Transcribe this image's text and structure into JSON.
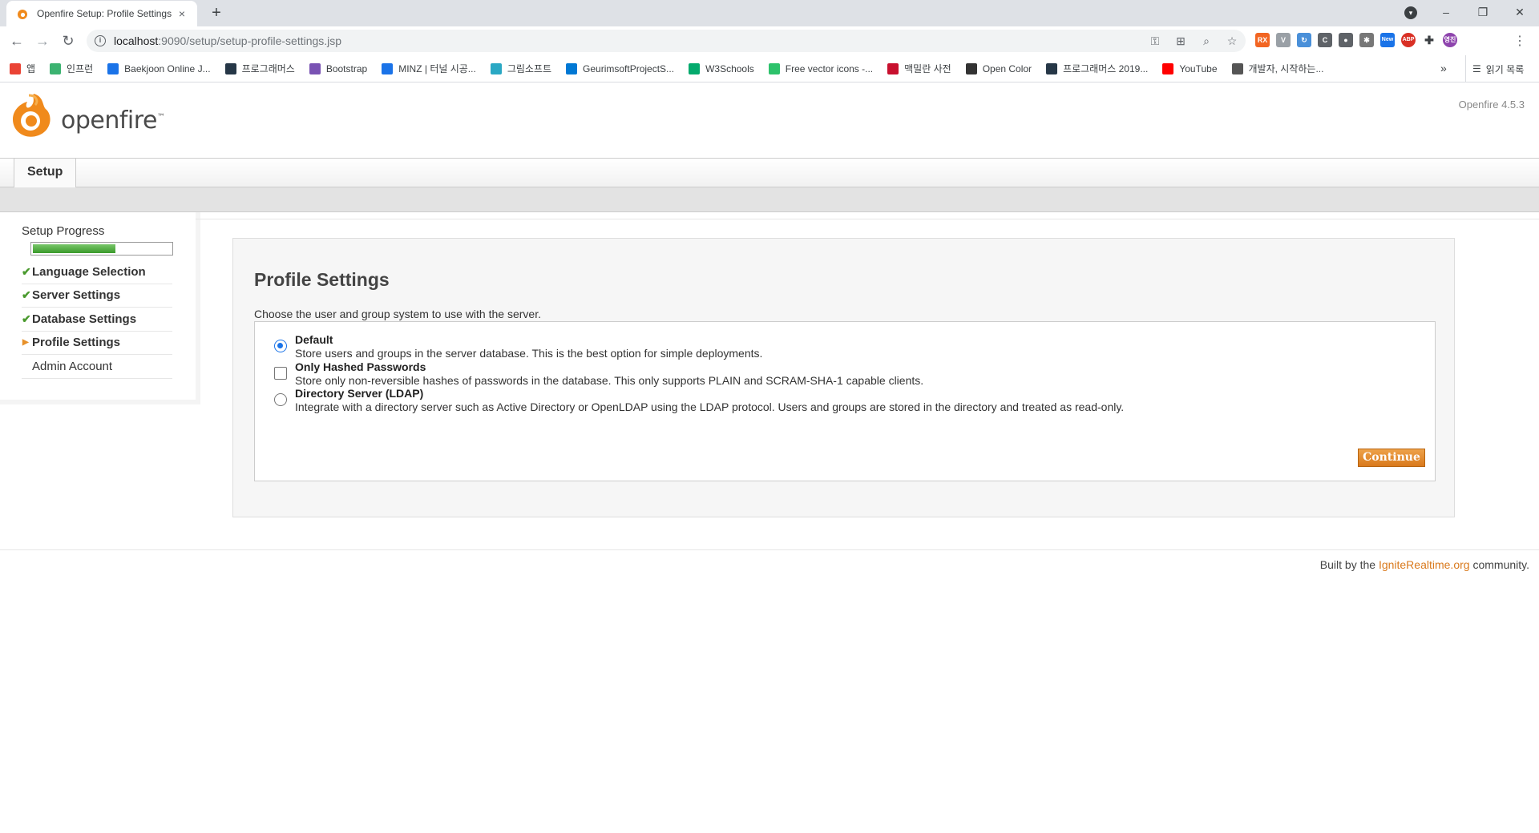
{
  "browser": {
    "tab_title": "Openfire Setup: Profile Settings",
    "tab_close": "×",
    "new_tab": "+",
    "url_host": "localhost",
    "url_path": ":9090/setup/setup-profile-settings.jsp",
    "win_minimize": "–",
    "win_restore": "❐",
    "win_close": "✕",
    "ext_badge_new": "New",
    "profile_initials": "영진"
  },
  "bookmarks": [
    {
      "label": "앱",
      "icon": "apps-grid-icon",
      "color": "#ea4335"
    },
    {
      "label": "인프런",
      "icon": "inflearn-icon",
      "color": "#3cb371"
    },
    {
      "label": "Baekjoon Online J...",
      "icon": "code-icon",
      "color": "#1a73e8"
    },
    {
      "label": "프로그래머스",
      "icon": "programmers-icon",
      "color": "#263747"
    },
    {
      "label": "Bootstrap",
      "icon": "bootstrap-icon",
      "color": "#7952b3"
    },
    {
      "label": "MINZ | 터널 시공...",
      "icon": "minz-icon",
      "color": "#1a73e8"
    },
    {
      "label": "그림소프트",
      "icon": "grimsoft-icon",
      "color": "#2aa8c4"
    },
    {
      "label": "GeurimsoftProjectS...",
      "icon": "onedrive-icon",
      "color": "#0078d4"
    },
    {
      "label": "W3Schools",
      "icon": "w3schools-icon",
      "color": "#04aa6d"
    },
    {
      "label": "Free vector icons -...",
      "icon": "flaticon-icon",
      "color": "#2dc26b"
    },
    {
      "label": "맥밀란 사전",
      "icon": "macmillan-icon",
      "color": "#c8102e"
    },
    {
      "label": "Open Color",
      "icon": "opencolor-icon",
      "color": "#333333"
    },
    {
      "label": "프로그래머스 2019...",
      "icon": "programmers-icon",
      "color": "#263747"
    },
    {
      "label": "YouTube",
      "icon": "youtube-icon",
      "color": "#ff0000"
    },
    {
      "label": "개발자, 시작하는...",
      "icon": "pen-icon",
      "color": "#555555"
    }
  ],
  "bookmarks_more": "»",
  "reading_list": "읽기 목록",
  "header": {
    "logo_text": "openfire",
    "logo_tm": "™",
    "version": "Openfire 4.5.3"
  },
  "nav": {
    "tab_setup": "Setup"
  },
  "sidebar": {
    "title": "Setup Progress",
    "progress": 0.6,
    "items": [
      {
        "label": "Language Selection",
        "state": "done"
      },
      {
        "label": "Server Settings",
        "state": "done"
      },
      {
        "label": "Database Settings",
        "state": "done"
      },
      {
        "label": "Profile Settings",
        "state": "current"
      },
      {
        "label": "Admin Account",
        "state": "pending"
      }
    ]
  },
  "main": {
    "title": "Profile Settings",
    "description": "Choose the user and group system to use with the server.",
    "options": [
      {
        "name": "Default",
        "desc": "Store users and groups in the server database. This is the best option for simple deployments.",
        "type": "radio",
        "checked": true
      },
      {
        "name": "Only Hashed Passwords",
        "desc": "Store only non-reversible hashes of passwords in the database. This only supports PLAIN and SCRAM-SHA-1 capable clients.",
        "type": "checkbox",
        "checked": false
      },
      {
        "name": "Directory Server (LDAP)",
        "desc": "Integrate with a directory server such as Active Directory or OpenLDAP using the LDAP protocol. Users and groups are stored in the directory and treated as read-only.",
        "type": "radio",
        "checked": false
      }
    ],
    "continue_label": "Continue"
  },
  "footer": {
    "prefix": "Built by the",
    "link": "IgniteRealtime.org",
    "suffix": "community."
  },
  "colors": {
    "accent_orange": "#d9791c",
    "progress_green": "#3a9a2b",
    "check_green": "#4a9a2e"
  }
}
